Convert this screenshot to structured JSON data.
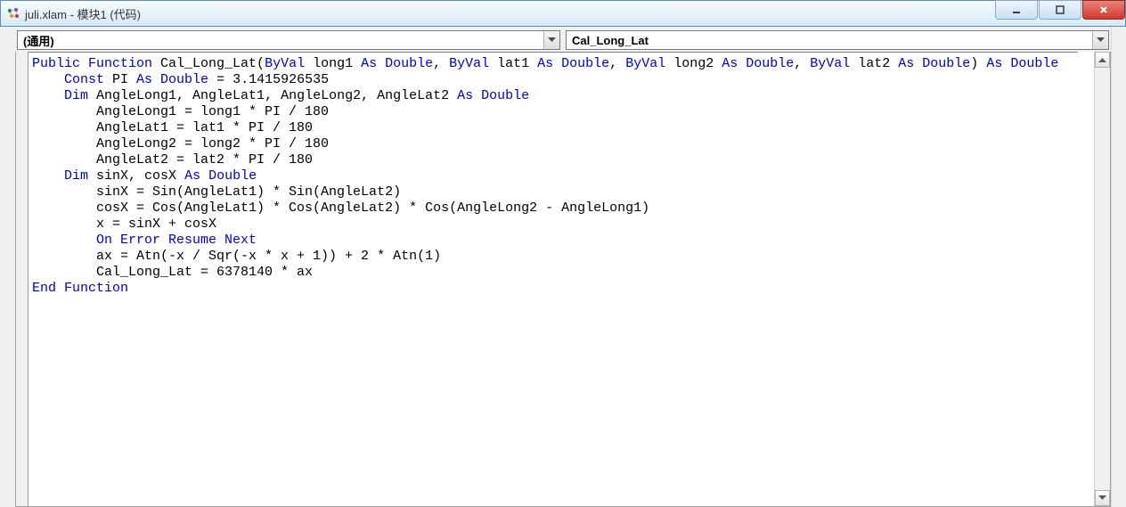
{
  "window": {
    "title": "juli.xlam - 模块1 (代码)"
  },
  "dropdowns": {
    "left": "(通用)",
    "right": "Cal_Long_Lat"
  },
  "code": {
    "tokens": [
      [
        [
          "kw",
          "Public Function"
        ],
        [
          "",
          " Cal_Long_Lat("
        ],
        [
          "kw",
          "ByVal"
        ],
        [
          "",
          " long1 "
        ],
        [
          "kw",
          "As Double"
        ],
        [
          "",
          ", "
        ],
        [
          "kw",
          "ByVal"
        ],
        [
          "",
          " lat1 "
        ],
        [
          "kw",
          "As Double"
        ],
        [
          "",
          ", "
        ],
        [
          "kw",
          "ByVal"
        ],
        [
          "",
          " long2 "
        ],
        [
          "kw",
          "As Double"
        ],
        [
          "",
          ", "
        ],
        [
          "kw",
          "ByVal"
        ],
        [
          "",
          " lat2 "
        ],
        [
          "kw",
          "As Double"
        ],
        [
          "",
          ") "
        ],
        [
          "kw",
          "As Double"
        ]
      ],
      [
        [
          "",
          "    "
        ],
        [
          "kw",
          "Const"
        ],
        [
          "",
          " PI "
        ],
        [
          "kw",
          "As Double"
        ],
        [
          "",
          " = 3.1415926535"
        ]
      ],
      [
        [
          "",
          "    "
        ],
        [
          "kw",
          "Dim"
        ],
        [
          "",
          " AngleLong1, AngleLat1, AngleLong2, AngleLat2 "
        ],
        [
          "kw",
          "As Double"
        ]
      ],
      [
        [
          "",
          "        AngleLong1 = long1 * PI / 180"
        ]
      ],
      [
        [
          "",
          "        AngleLat1 = lat1 * PI / 180"
        ]
      ],
      [
        [
          "",
          "        AngleLong2 = long2 * PI / 180"
        ]
      ],
      [
        [
          "",
          "        AngleLat2 = lat2 * PI / 180"
        ]
      ],
      [
        [
          "",
          "    "
        ],
        [
          "kw",
          "Dim"
        ],
        [
          "",
          " sinX, cosX "
        ],
        [
          "kw",
          "As Double"
        ]
      ],
      [
        [
          "",
          "        sinX = Sin(AngleLat1) * Sin(AngleLat2)"
        ]
      ],
      [
        [
          "",
          "        cosX = Cos(AngleLat1) * Cos(AngleLat2) * Cos(AngleLong2 - AngleLong1)"
        ]
      ],
      [
        [
          "",
          "        x = sinX + cosX"
        ]
      ],
      [
        [
          "",
          "        "
        ],
        [
          "kw",
          "On Error Resume Next"
        ]
      ],
      [
        [
          "",
          "        ax = Atn(-x / Sqr(-x * x + 1)) + 2 * Atn(1)"
        ]
      ],
      [
        [
          "",
          "        Cal_Long_Lat = 6378140 * ax"
        ]
      ],
      [
        [
          "kw",
          "End Function"
        ]
      ]
    ]
  }
}
